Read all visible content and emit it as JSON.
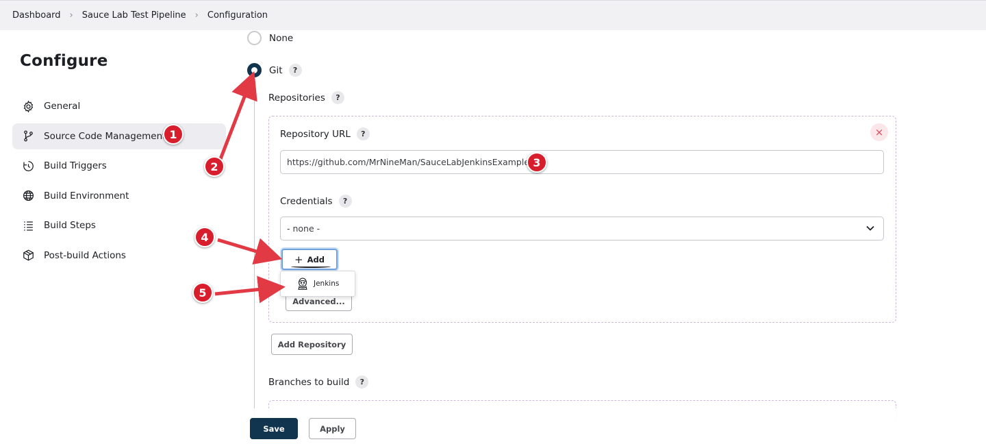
{
  "breadcrumb": [
    "Dashboard",
    "Sauce Lab Test Pipeline",
    "Configuration"
  ],
  "page_title": "Configure",
  "sidebar": {
    "items": [
      {
        "label": "General",
        "icon": "gear-icon",
        "active": false
      },
      {
        "label": "Source Code Management",
        "icon": "branch-icon",
        "active": true
      },
      {
        "label": "Build Triggers",
        "icon": "timer-icon",
        "active": false
      },
      {
        "label": "Build Environment",
        "icon": "globe-icon",
        "active": false
      },
      {
        "label": "Build Steps",
        "icon": "list-icon",
        "active": false
      },
      {
        "label": "Post-build Actions",
        "icon": "box-icon",
        "active": false
      }
    ]
  },
  "scm": {
    "option_none": "None",
    "option_git": "Git",
    "selected": "Git",
    "help_glyph": "?",
    "repositories_label": "Repositories",
    "repository_url_label": "Repository URL",
    "repository_url_value": "https://github.com/MrNineMan/SauceLabJenkinsExample",
    "credentials_label": "Credentials",
    "credentials_value": "- none -",
    "add_button": "Add",
    "add_dropdown_item": "Jenkins",
    "advanced_button": "Advanced...",
    "add_repository_button": "Add Repository",
    "branches_label": "Branches to build",
    "remove_glyph": "×"
  },
  "footer": {
    "save": "Save",
    "apply": "Apply"
  },
  "annotations": [
    "1",
    "2",
    "3",
    "4",
    "5"
  ],
  "colors": {
    "accent": "#11344f",
    "annotation_red": "#d81e2d",
    "dashed_border": "#cdb8dc"
  }
}
